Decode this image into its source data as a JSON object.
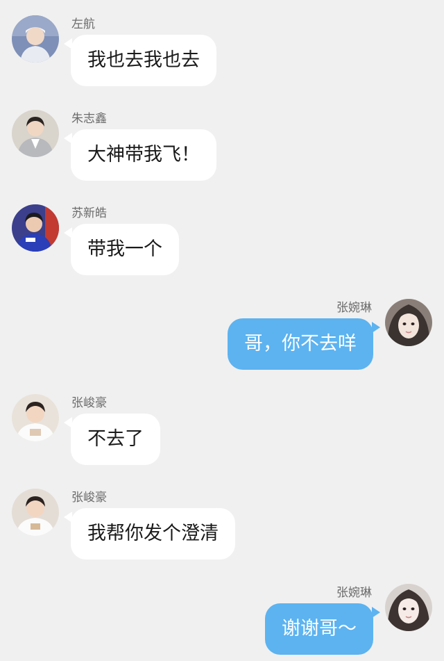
{
  "colors": {
    "background": "#f0f0f0",
    "incoming_bubble": "#ffffff",
    "outgoing_bubble": "#5cb3f0",
    "name_text": "#6b6b6b"
  },
  "messages": [
    {
      "side": "left",
      "sender": "左航",
      "text": "我也去我也去",
      "avatar": "avatar-zuohang"
    },
    {
      "side": "left",
      "sender": "朱志鑫",
      "text": "大神带我飞！",
      "avatar": "avatar-zhuzhixin"
    },
    {
      "side": "left",
      "sender": "苏新皓",
      "text": "带我一个",
      "avatar": "avatar-suxinhao"
    },
    {
      "side": "right",
      "sender": "张婉琳",
      "text": "哥，你不去咩",
      "avatar": "avatar-zhangwanlin"
    },
    {
      "side": "left",
      "sender": "张峻豪",
      "text": "不去了",
      "avatar": "avatar-zhangjunhao"
    },
    {
      "side": "left",
      "sender": "张峻豪",
      "text": "我帮你发个澄清",
      "avatar": "avatar-zhangjunhao"
    },
    {
      "side": "right",
      "sender": "张婉琳",
      "text": "谢谢哥～",
      "avatar": "avatar-zhangwanlin"
    }
  ]
}
